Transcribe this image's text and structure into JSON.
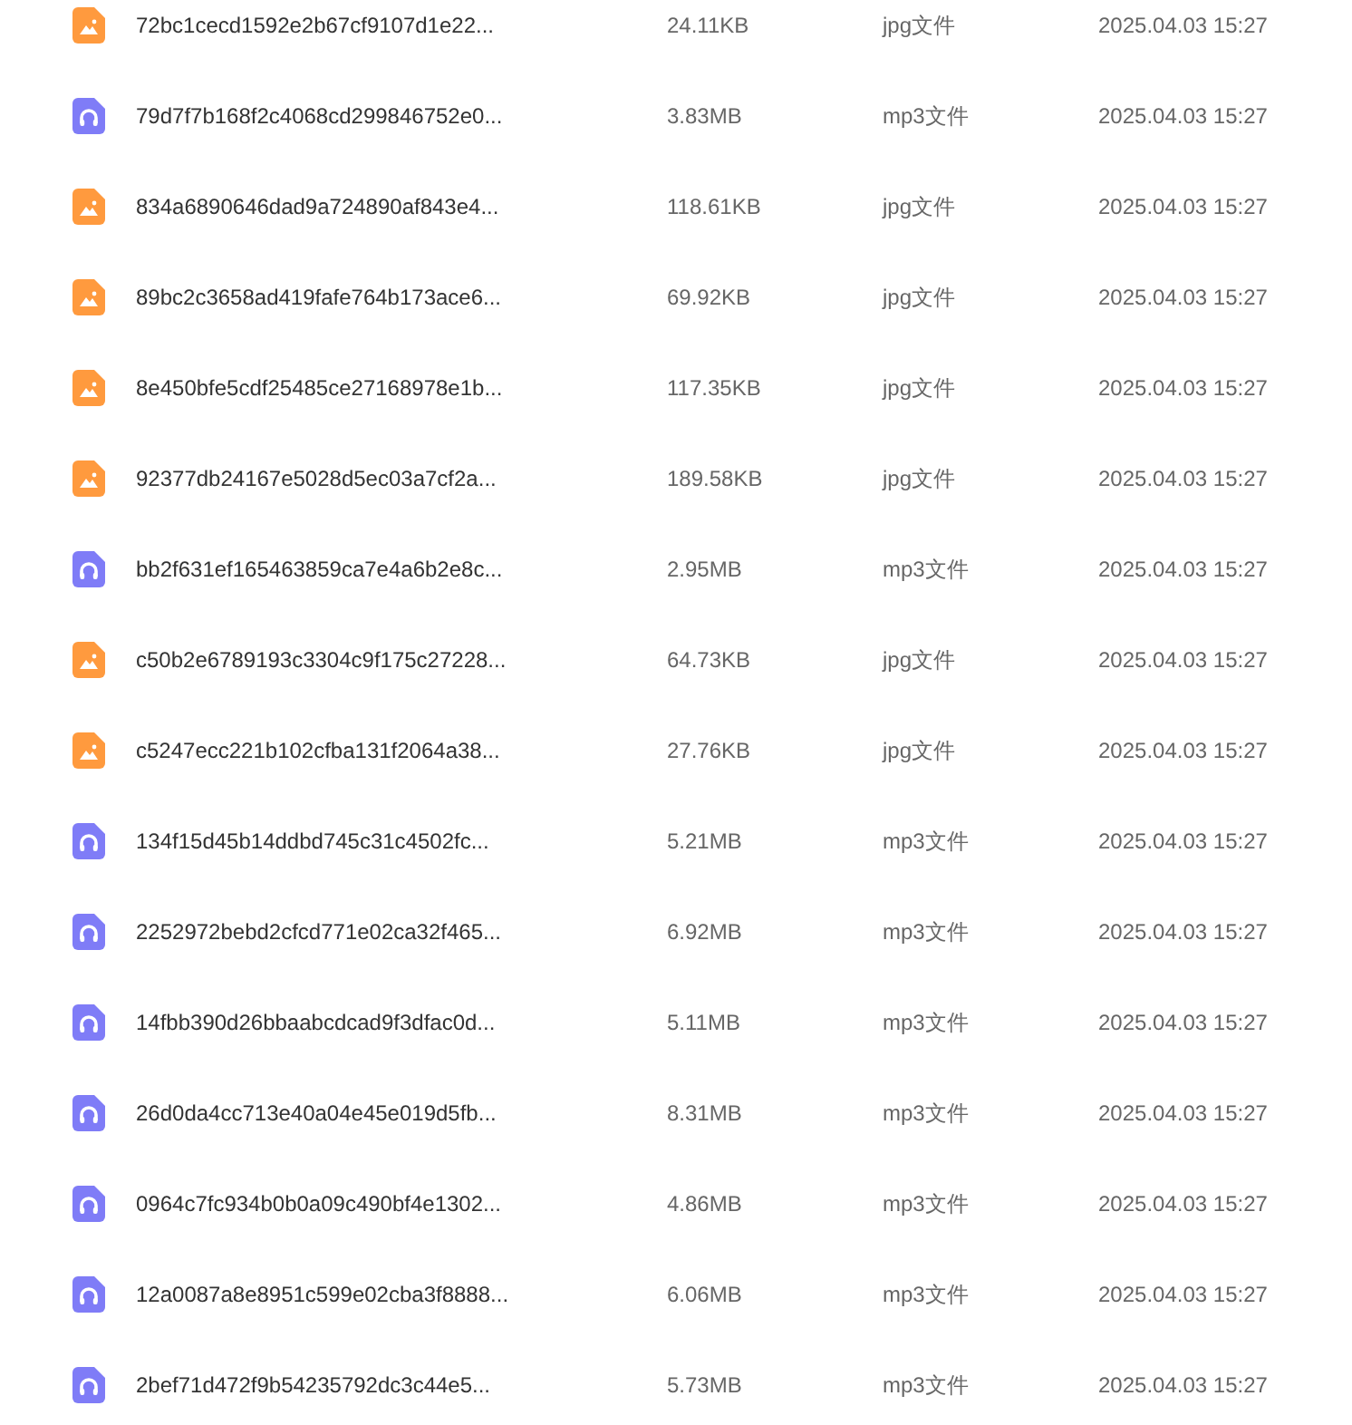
{
  "files": [
    {
      "kind": "image",
      "name": "72bc1cecd1592e2b67cf9107d1e22...",
      "size": "24.11KB",
      "type": "jpg文件",
      "date": "2025.04.03 15:27"
    },
    {
      "kind": "audio",
      "name": "79d7f7b168f2c4068cd299846752e0...",
      "size": "3.83MB",
      "type": "mp3文件",
      "date": "2025.04.03 15:27"
    },
    {
      "kind": "image",
      "name": "834a6890646dad9a724890af843e4...",
      "size": "118.61KB",
      "type": "jpg文件",
      "date": "2025.04.03 15:27"
    },
    {
      "kind": "image",
      "name": "89bc2c3658ad419fafe764b173ace6...",
      "size": "69.92KB",
      "type": "jpg文件",
      "date": "2025.04.03 15:27"
    },
    {
      "kind": "image",
      "name": "8e450bfe5cdf25485ce27168978e1b...",
      "size": "117.35KB",
      "type": "jpg文件",
      "date": "2025.04.03 15:27"
    },
    {
      "kind": "image",
      "name": "92377db24167e5028d5ec03a7cf2a...",
      "size": "189.58KB",
      "type": "jpg文件",
      "date": "2025.04.03 15:27"
    },
    {
      "kind": "audio",
      "name": "bb2f631ef165463859ca7e4a6b2e8c...",
      "size": "2.95MB",
      "type": "mp3文件",
      "date": "2025.04.03 15:27"
    },
    {
      "kind": "image",
      "name": "c50b2e6789193c3304c9f175c27228...",
      "size": "64.73KB",
      "type": "jpg文件",
      "date": "2025.04.03 15:27"
    },
    {
      "kind": "image",
      "name": "c5247ecc221b102cfba131f2064a38...",
      "size": "27.76KB",
      "type": "jpg文件",
      "date": "2025.04.03 15:27"
    },
    {
      "kind": "audio",
      "name": "134f15d45b14ddbd745c31c4502fc...",
      "size": "5.21MB",
      "type": "mp3文件",
      "date": "2025.04.03 15:27"
    },
    {
      "kind": "audio",
      "name": "2252972bebd2cfcd771e02ca32f465...",
      "size": "6.92MB",
      "type": "mp3文件",
      "date": "2025.04.03 15:27"
    },
    {
      "kind": "audio",
      "name": "14fbb390d26bbaabcdcad9f3dfac0d...",
      "size": "5.11MB",
      "type": "mp3文件",
      "date": "2025.04.03 15:27"
    },
    {
      "kind": "audio",
      "name": "26d0da4cc713e40a04e45e019d5fb...",
      "size": "8.31MB",
      "type": "mp3文件",
      "date": "2025.04.03 15:27"
    },
    {
      "kind": "audio",
      "name": "0964c7fc934b0b0a09c490bf4e1302...",
      "size": "4.86MB",
      "type": "mp3文件",
      "date": "2025.04.03 15:27"
    },
    {
      "kind": "audio",
      "name": "12a0087a8e8951c599e02cba3f8888...",
      "size": "6.06MB",
      "type": "mp3文件",
      "date": "2025.04.03 15:27"
    },
    {
      "kind": "audio",
      "name": "2bef71d472f9b54235792dc3c44e5...",
      "size": "5.73MB",
      "type": "mp3文件",
      "date": "2025.04.03 15:27"
    }
  ]
}
